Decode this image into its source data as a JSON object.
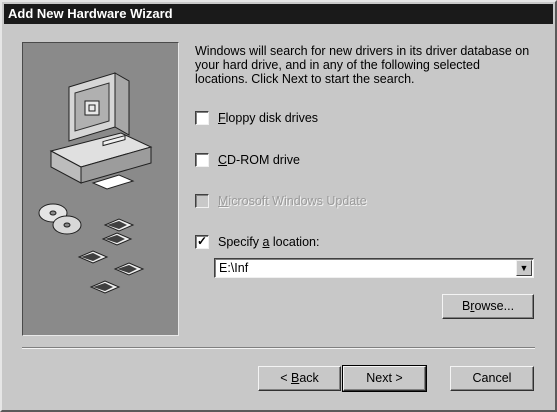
{
  "window": {
    "title": "Add New Hardware Wizard"
  },
  "main": {
    "description": "Windows will search for new drivers in its driver database on your hard drive, and in any of the following selected locations. Click Next to start the search.",
    "options": [
      {
        "label_hotkey": "F",
        "label_rest": "loppy disk drives",
        "checked": false,
        "enabled": true
      },
      {
        "label_hotkey": "C",
        "label_rest": "D-ROM drive",
        "checked": false,
        "enabled": true
      },
      {
        "label_hotkey": "M",
        "label_rest": "icrosoft Windows Update",
        "checked": false,
        "enabled": false
      },
      {
        "label_prefix": "Specify ",
        "label_hotkey": "a",
        "label_rest": " location:",
        "checked": true,
        "enabled": true
      }
    ],
    "location": {
      "value": "E:\\Inf"
    },
    "browse_button": {
      "prefix": "B",
      "hotkey": "r",
      "rest": "owse..."
    }
  },
  "footer": {
    "back": {
      "prefix": "< ",
      "hotkey": "B",
      "rest": "ack"
    },
    "next": "Next >",
    "cancel": "Cancel"
  },
  "icons": {
    "art": "computer-with-discs-illustration",
    "check": "checkmark-glyph",
    "dropdown": "down-arrow-icon"
  },
  "colors": {
    "title_bar": "#1a1a1a",
    "dialog_face": "#c8c8c8",
    "art_panel": "#8a8a8a"
  }
}
